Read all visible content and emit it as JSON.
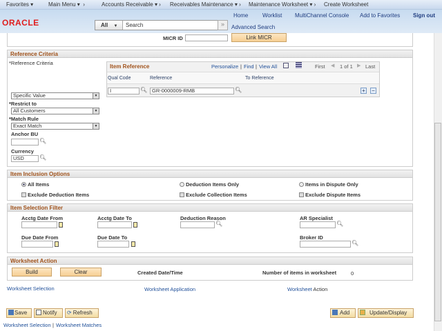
{
  "breadcrumb": [
    "Favorites",
    "Main Menu",
    "Accounts Receivable",
    "Receivables Maintenance",
    "Maintenance Worksheet",
    "Create Worksheet"
  ],
  "header_links": [
    "Home",
    "Worklist",
    "MultiChannel Console",
    "Add to Favorites",
    "Sign out"
  ],
  "logo": "ORACLE",
  "search": {
    "scope": "All",
    "placeholder": "Search",
    "advanced": "Advanced Search"
  },
  "micr": {
    "label": "MICR ID",
    "value": "",
    "button": "Link MICR"
  },
  "reference_criteria": {
    "title": "Reference Criteria",
    "label": "*Reference Criteria",
    "value": "Specific Value",
    "restrict_label": "*Restrict to",
    "restrict_value": "All Customers",
    "match_label": "*Match Rule",
    "match_value": "Exact Match",
    "anchor_label": "Anchor BU",
    "anchor_value": "",
    "currency_label": "Currency",
    "currency_value": "USD"
  },
  "item_reference": {
    "title": "Item Reference",
    "personalize": "Personalize",
    "find": "Find",
    "view_all": "View All",
    "first": "First",
    "count": "1 of 1",
    "last": "Last",
    "columns": [
      "Qual Code",
      "Reference",
      "To Reference"
    ],
    "rows": [
      {
        "qual_code": "I",
        "reference": "GR-0000009-RMB",
        "to_reference": ""
      }
    ]
  },
  "inclusion": {
    "title": "Item Inclusion Options",
    "radios": [
      {
        "label": "All Items",
        "checked": true
      },
      {
        "label": "Deduction Items Only",
        "checked": false
      },
      {
        "label": "Items in Dispute Only",
        "checked": false
      }
    ],
    "checks": [
      {
        "label": "Exclude Deduction Items",
        "checked": false
      },
      {
        "label": "Exclude Collection Items",
        "checked": false
      },
      {
        "label": "Exclude Dispute Items",
        "checked": false
      }
    ]
  },
  "filter": {
    "title": "Item Selection Filter",
    "acctg_from": "Acctg Date From",
    "acctg_to": "Acctg Date To",
    "deduction_reason": "Deduction Reason",
    "ar_specialist": "AR Specialist",
    "due_from": "Due Date From",
    "due_to": "Due Date To",
    "broker_id": "Broker ID"
  },
  "action": {
    "title": "Worksheet Action",
    "build": "Build",
    "clear": "Clear",
    "created_label": "Created Date/Time",
    "count_label": "Number of items in worksheet",
    "count": "0"
  },
  "tabs": [
    {
      "a": "Worksheet ",
      "b": "Selection"
    },
    {
      "a": "Worksheet Application",
      "b": ""
    },
    {
      "a": "Worksheet ",
      "b": "Action"
    }
  ],
  "toolbar": {
    "save": "Save",
    "notify": "Notify",
    "refresh": "Refresh",
    "add": "Add",
    "update": "Update/Display"
  },
  "footer_links": [
    "Worksheet Selection",
    "Worksheet Matches"
  ]
}
